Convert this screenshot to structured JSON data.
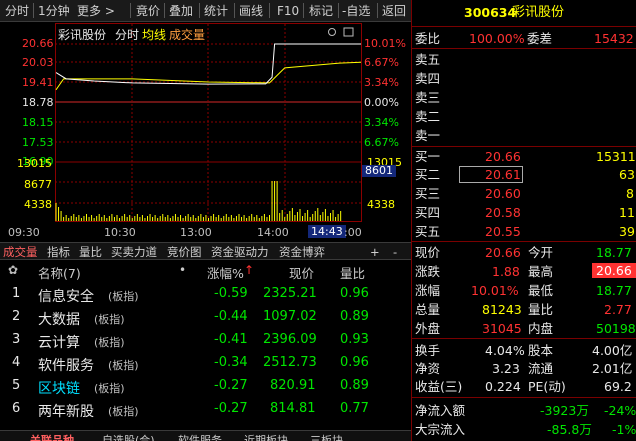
{
  "toolbar": {
    "items": [
      "分时",
      "1分钟",
      "更多 >",
      "竟价",
      "叠加",
      "统计",
      "画线",
      "F10",
      "标记",
      "-自选",
      "返回"
    ]
  },
  "chart": {
    "stock_name": "彩讯股份",
    "mode": "分时",
    "avg_label": "均线",
    "vol_label": "成交量",
    "price_levels": [
      "20.66",
      "20.03",
      "19.41",
      "18.78",
      "18.15",
      "17.53",
      "16.90"
    ],
    "pct_levels": [
      "10.01%",
      "6.67%",
      "3.34%",
      "0.00%",
      "3.34%",
      "6.67%",
      "10.01%"
    ],
    "vol_levels_left": [
      "13015",
      "8677",
      "4338"
    ],
    "vol_levels_right": [
      "13015",
      "8601",
      "4338"
    ],
    "time_labels": [
      "09:30",
      "10:30",
      "13:00",
      "14:00"
    ],
    "cursor_time": "14:43",
    "cursor_end": ":00"
  },
  "lower_tabs": [
    "成交量",
    "指标",
    "量比",
    "买卖力道",
    "竞价图",
    "资金驱动力",
    "资金博弈",
    "+",
    "-"
  ],
  "table": {
    "headers": {
      "name": "名称(7)",
      "dot": "•",
      "change": "涨幅%",
      "price": "现价",
      "ratio": "量比"
    },
    "rows": [
      {
        "idx": "1",
        "name": "信息安全",
        "tag": "(板指)",
        "change": "-0.59",
        "price": "2325.21",
        "ratio": "0.96"
      },
      {
        "idx": "2",
        "name": "大数据",
        "tag": "(板指)",
        "change": "-0.44",
        "price": "1097.02",
        "ratio": "0.89"
      },
      {
        "idx": "3",
        "name": "云计算",
        "tag": "(板指)",
        "change": "-0.41",
        "price": "2396.09",
        "ratio": "0.93"
      },
      {
        "idx": "4",
        "name": "软件服务",
        "tag": "(板指)",
        "change": "-0.34",
        "price": "2512.73",
        "ratio": "0.96"
      },
      {
        "idx": "5",
        "name": "区块链",
        "tag": "(板指)",
        "change": "-0.27",
        "price": "820.91",
        "ratio": "0.89"
      },
      {
        "idx": "6",
        "name": "两年新股",
        "tag": "(板指)",
        "change": "-0.27",
        "price": "814.81",
        "ratio": "0.77"
      }
    ]
  },
  "panel": {
    "code": "300634",
    "name": "彩讯股份",
    "weibi_label": "委比",
    "weibi_value": "100.00%",
    "weicha_label": "委差",
    "weicha_value": "15432",
    "sells": [
      {
        "label": "卖五",
        "price": "",
        "vol": ""
      },
      {
        "label": "卖四",
        "price": "",
        "vol": ""
      },
      {
        "label": "卖三",
        "price": "",
        "vol": ""
      },
      {
        "label": "卖二",
        "price": "",
        "vol": ""
      },
      {
        "label": "卖一",
        "price": "",
        "vol": ""
      }
    ],
    "buys": [
      {
        "label": "买一",
        "price": "20.66",
        "vol": "15311"
      },
      {
        "label": "买二",
        "price": "20.61",
        "vol": "63"
      },
      {
        "label": "买三",
        "price": "20.60",
        "vol": "8"
      },
      {
        "label": "买四",
        "price": "20.58",
        "vol": "11"
      },
      {
        "label": "买五",
        "price": "20.55",
        "vol": "39"
      }
    ],
    "stats": [
      {
        "l1": "现价",
        "v1": "20.66",
        "c1": "red",
        "l2": "今开",
        "v2": "18.77",
        "c2": "green"
      },
      {
        "l1": "涨跌",
        "v1": "1.88",
        "c1": "red",
        "l2": "最高",
        "v2": "20.66",
        "c2": "red"
      },
      {
        "l1": "涨幅",
        "v1": "10.01%",
        "c1": "red",
        "l2": "最低",
        "v2": "18.77",
        "c2": "green"
      },
      {
        "l1": "总量",
        "v1": "81243",
        "c1": "yellow",
        "l2": "量比",
        "v2": "2.77",
        "c2": "red"
      },
      {
        "l1": "外盘",
        "v1": "31045",
        "c1": "red",
        "l2": "内盘",
        "v2": "50198",
        "c2": "green"
      }
    ],
    "stats2": [
      {
        "l1": "换手",
        "v1": "4.04%",
        "l2": "股本",
        "v2": "4.00亿"
      },
      {
        "l1": "净资",
        "v1": "3.23",
        "l2": "流通",
        "v2": "2.01亿"
      },
      {
        "l1": "收益(三)",
        "v1": "0.224",
        "l2": "PE(动)",
        "v2": "69.2"
      }
    ],
    "flow": [
      {
        "label": "净流入额",
        "value": "-3923万",
        "pct": "-24%"
      },
      {
        "label": "大宗流入",
        "value": "-85.8万",
        "pct": "-1%"
      }
    ]
  },
  "bottom_tabs": [
    "关联品种",
    "自选股(合)",
    "软件服务",
    "近期板块",
    "三板块"
  ],
  "colors": {
    "up": "#ff3232",
    "down": "#00e600",
    "price_line": "#ffffff",
    "avg_line": "#ffff00",
    "grid_red": "#8b0000"
  },
  "chart_data": {
    "type": "line",
    "title": "彩讯股份",
    "xlabel": "",
    "ylabel": "",
    "x": [
      "09:30",
      "10:30",
      "13:00",
      "14:00",
      "14:43"
    ],
    "ylim": [
      16.9,
      20.66
    ],
    "series": [
      {
        "name": "分时",
        "values": [
          19.75,
          19.42,
          19.38,
          19.39,
          20.66
        ]
      },
      {
        "name": "均线",
        "values": [
          19.55,
          19.55,
          19.45,
          19.42,
          20.05
        ]
      }
    ]
  }
}
